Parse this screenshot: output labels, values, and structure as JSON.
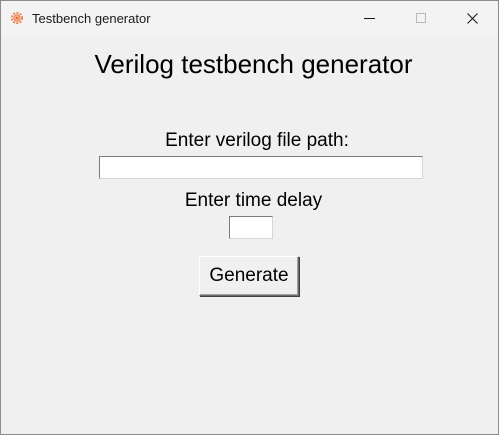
{
  "window": {
    "title": "Testbench generator",
    "icon": "gear-chip-icon",
    "controls": {
      "minimize_icon": "minimize-icon",
      "maximize_icon": "maximize-icon",
      "close_icon": "close-icon"
    }
  },
  "form": {
    "heading": "Verilog testbench generator",
    "file_path_label": "Enter verilog file path:",
    "file_path_value": "",
    "time_delay_label": "Enter time delay",
    "time_delay_value": "",
    "generate_label": "Generate"
  },
  "colors": {
    "background": "#f0f0f0",
    "titlebar": "#f3f3f3",
    "app_icon_accent": "#e8743b"
  }
}
